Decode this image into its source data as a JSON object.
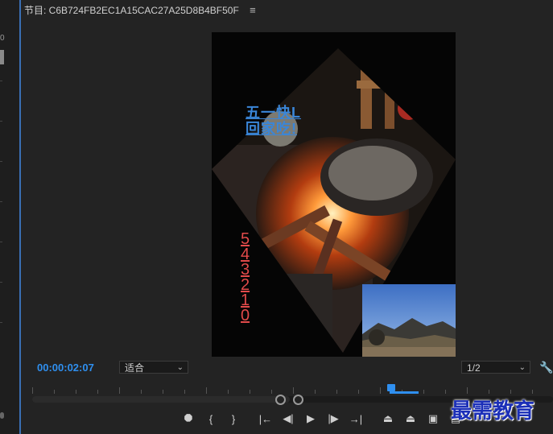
{
  "left_panel": {
    "number_label": "0"
  },
  "title_bar": {
    "label": "节目: C6B724FB2EC1A15CAC27A25D8B4BF50F",
    "menu_icon": "hamburger-menu-icon"
  },
  "viewer": {
    "headline_line1": "五一快L",
    "headline_line2": "回家吃!",
    "countdown": [
      "5",
      "4",
      "3",
      "2",
      "1",
      "0"
    ],
    "accent_colors": {
      "headline": "#3a86d8",
      "countdown": "#e24a4a"
    }
  },
  "controls": {
    "timecode": "00:00:02:07",
    "zoom_value": "适合",
    "resolution_value": "1/2",
    "settings_icon": "wrench-icon"
  },
  "transport": {
    "buttons": [
      {
        "icon": "add-marker-icon",
        "glyph": "⯃"
      },
      {
        "icon": "mark-in-icon",
        "glyph": "{"
      },
      {
        "icon": "mark-out-icon",
        "glyph": "}"
      },
      {
        "icon": "go-to-in-icon",
        "glyph": "|←"
      },
      {
        "icon": "step-back-icon",
        "glyph": "◀|"
      },
      {
        "icon": "play-icon",
        "glyph": "▶"
      },
      {
        "icon": "step-forward-icon",
        "glyph": "|▶"
      },
      {
        "icon": "go-to-out-icon",
        "glyph": "→|"
      },
      {
        "icon": "lift-icon",
        "glyph": "⏏"
      },
      {
        "icon": "extract-icon",
        "glyph": "⏏"
      },
      {
        "icon": "export-frame-icon",
        "glyph": "▣"
      },
      {
        "icon": "compare-icon",
        "glyph": "▤"
      }
    ]
  },
  "watermark": {
    "text": "最需教育"
  },
  "theme": {
    "accent": "#2f8fef",
    "background": "#232323"
  }
}
